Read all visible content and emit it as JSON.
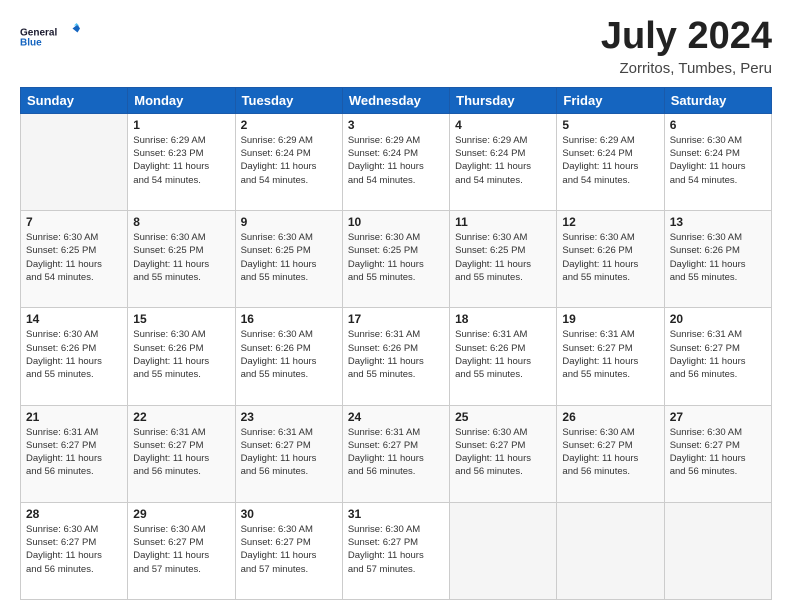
{
  "logo": {
    "line1": "General",
    "line2": "Blue"
  },
  "title": "July 2024",
  "subtitle": "Zorritos, Tumbes, Peru",
  "days_of_week": [
    "Sunday",
    "Monday",
    "Tuesday",
    "Wednesday",
    "Thursday",
    "Friday",
    "Saturday"
  ],
  "weeks": [
    [
      {
        "num": "",
        "text": ""
      },
      {
        "num": "1",
        "text": "Sunrise: 6:29 AM\nSunset: 6:23 PM\nDaylight: 11 hours\nand 54 minutes."
      },
      {
        "num": "2",
        "text": "Sunrise: 6:29 AM\nSunset: 6:24 PM\nDaylight: 11 hours\nand 54 minutes."
      },
      {
        "num": "3",
        "text": "Sunrise: 6:29 AM\nSunset: 6:24 PM\nDaylight: 11 hours\nand 54 minutes."
      },
      {
        "num": "4",
        "text": "Sunrise: 6:29 AM\nSunset: 6:24 PM\nDaylight: 11 hours\nand 54 minutes."
      },
      {
        "num": "5",
        "text": "Sunrise: 6:29 AM\nSunset: 6:24 PM\nDaylight: 11 hours\nand 54 minutes."
      },
      {
        "num": "6",
        "text": "Sunrise: 6:30 AM\nSunset: 6:24 PM\nDaylight: 11 hours\nand 54 minutes."
      }
    ],
    [
      {
        "num": "7",
        "text": "Sunrise: 6:30 AM\nSunset: 6:25 PM\nDaylight: 11 hours\nand 54 minutes."
      },
      {
        "num": "8",
        "text": "Sunrise: 6:30 AM\nSunset: 6:25 PM\nDaylight: 11 hours\nand 55 minutes."
      },
      {
        "num": "9",
        "text": "Sunrise: 6:30 AM\nSunset: 6:25 PM\nDaylight: 11 hours\nand 55 minutes."
      },
      {
        "num": "10",
        "text": "Sunrise: 6:30 AM\nSunset: 6:25 PM\nDaylight: 11 hours\nand 55 minutes."
      },
      {
        "num": "11",
        "text": "Sunrise: 6:30 AM\nSunset: 6:25 PM\nDaylight: 11 hours\nand 55 minutes."
      },
      {
        "num": "12",
        "text": "Sunrise: 6:30 AM\nSunset: 6:26 PM\nDaylight: 11 hours\nand 55 minutes."
      },
      {
        "num": "13",
        "text": "Sunrise: 6:30 AM\nSunset: 6:26 PM\nDaylight: 11 hours\nand 55 minutes."
      }
    ],
    [
      {
        "num": "14",
        "text": "Sunrise: 6:30 AM\nSunset: 6:26 PM\nDaylight: 11 hours\nand 55 minutes."
      },
      {
        "num": "15",
        "text": "Sunrise: 6:30 AM\nSunset: 6:26 PM\nDaylight: 11 hours\nand 55 minutes."
      },
      {
        "num": "16",
        "text": "Sunrise: 6:30 AM\nSunset: 6:26 PM\nDaylight: 11 hours\nand 55 minutes."
      },
      {
        "num": "17",
        "text": "Sunrise: 6:31 AM\nSunset: 6:26 PM\nDaylight: 11 hours\nand 55 minutes."
      },
      {
        "num": "18",
        "text": "Sunrise: 6:31 AM\nSunset: 6:26 PM\nDaylight: 11 hours\nand 55 minutes."
      },
      {
        "num": "19",
        "text": "Sunrise: 6:31 AM\nSunset: 6:27 PM\nDaylight: 11 hours\nand 55 minutes."
      },
      {
        "num": "20",
        "text": "Sunrise: 6:31 AM\nSunset: 6:27 PM\nDaylight: 11 hours\nand 56 minutes."
      }
    ],
    [
      {
        "num": "21",
        "text": "Sunrise: 6:31 AM\nSunset: 6:27 PM\nDaylight: 11 hours\nand 56 minutes."
      },
      {
        "num": "22",
        "text": "Sunrise: 6:31 AM\nSunset: 6:27 PM\nDaylight: 11 hours\nand 56 minutes."
      },
      {
        "num": "23",
        "text": "Sunrise: 6:31 AM\nSunset: 6:27 PM\nDaylight: 11 hours\nand 56 minutes."
      },
      {
        "num": "24",
        "text": "Sunrise: 6:31 AM\nSunset: 6:27 PM\nDaylight: 11 hours\nand 56 minutes."
      },
      {
        "num": "25",
        "text": "Sunrise: 6:30 AM\nSunset: 6:27 PM\nDaylight: 11 hours\nand 56 minutes."
      },
      {
        "num": "26",
        "text": "Sunrise: 6:30 AM\nSunset: 6:27 PM\nDaylight: 11 hours\nand 56 minutes."
      },
      {
        "num": "27",
        "text": "Sunrise: 6:30 AM\nSunset: 6:27 PM\nDaylight: 11 hours\nand 56 minutes."
      }
    ],
    [
      {
        "num": "28",
        "text": "Sunrise: 6:30 AM\nSunset: 6:27 PM\nDaylight: 11 hours\nand 56 minutes."
      },
      {
        "num": "29",
        "text": "Sunrise: 6:30 AM\nSunset: 6:27 PM\nDaylight: 11 hours\nand 57 minutes."
      },
      {
        "num": "30",
        "text": "Sunrise: 6:30 AM\nSunset: 6:27 PM\nDaylight: 11 hours\nand 57 minutes."
      },
      {
        "num": "31",
        "text": "Sunrise: 6:30 AM\nSunset: 6:27 PM\nDaylight: 11 hours\nand 57 minutes."
      },
      {
        "num": "",
        "text": ""
      },
      {
        "num": "",
        "text": ""
      },
      {
        "num": "",
        "text": ""
      }
    ]
  ]
}
